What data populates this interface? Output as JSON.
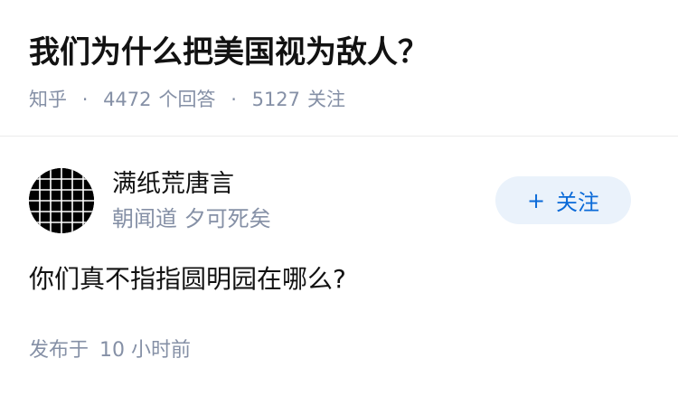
{
  "question": {
    "title": "我们为什么把美国视为敌人？",
    "source": "知乎",
    "separator": "·",
    "answer_count": "4472",
    "answer_count_label": "个回答",
    "follower_count": "5127",
    "follower_count_label": "关注"
  },
  "author": {
    "name": "满纸荒唐言",
    "bio": "朝闻道 夕可死矣",
    "avatar_icon": "grid-pattern-avatar",
    "follow_plus": "+",
    "follow_label": "关注"
  },
  "answer": {
    "content": "你们真不指指圆明园在哪么?",
    "time_prefix": "发布于",
    "time_value": "10 小时前"
  },
  "colors": {
    "text_primary": "#121212",
    "text_secondary": "#8590a6",
    "accent_blue": "#0a6ad8",
    "follow_bg": "#eaf2fb",
    "divider": "#ebebeb"
  }
}
